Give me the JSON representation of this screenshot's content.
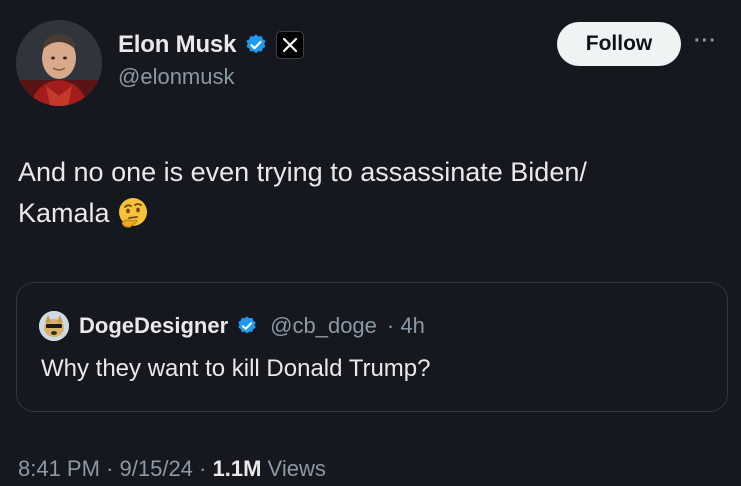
{
  "author": {
    "name": "Elon Musk",
    "handle": "@elonmusk",
    "badge_icon": "verified-badge-icon",
    "affiliate_icon": "x-logo-icon"
  },
  "actions": {
    "follow_label": "Follow",
    "more_label": "···"
  },
  "tweet": {
    "line1": "And no one is even trying to assassinate Biden/",
    "line2": "Kamala",
    "emoji": "thinking-face-icon"
  },
  "quote": {
    "name": "DogeDesigner",
    "handle": "@cb_doge",
    "time": "· 4h",
    "text": "Why they want to kill Donald Trump?"
  },
  "meta": {
    "time": "8:41 PM",
    "sep1": "·",
    "date": "9/15/24",
    "sep2": "·",
    "views_count": "1.1M",
    "views_label": "Views"
  },
  "colors": {
    "background": "#15181f",
    "verified_blue": "#1d9bf0",
    "secondary_text": "#8b98a5"
  }
}
